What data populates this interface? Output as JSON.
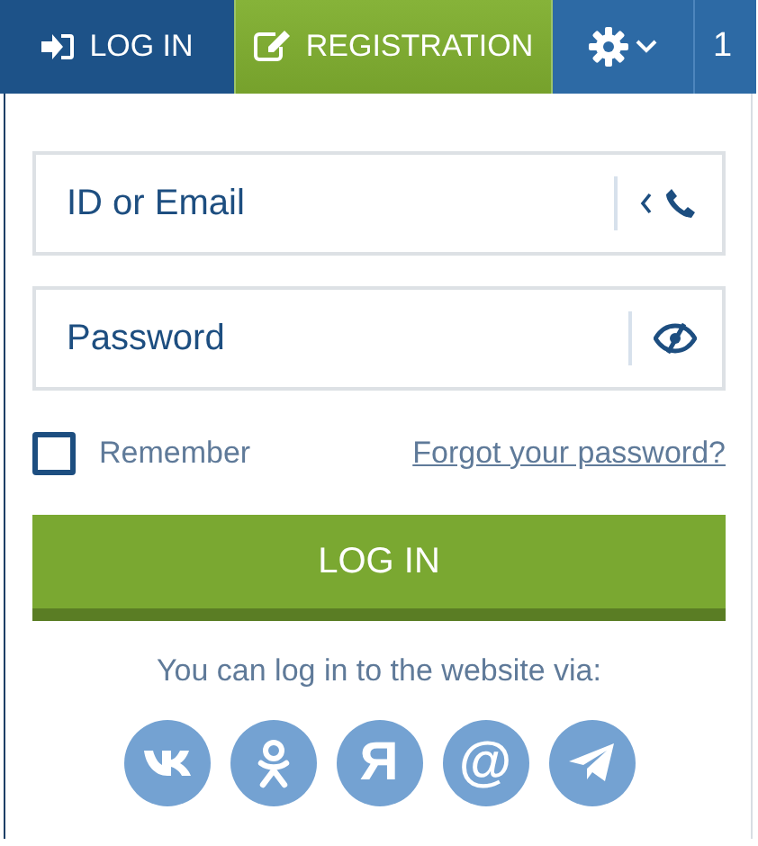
{
  "topbar": [
    {
      "kind": "login",
      "label": "LOG IN"
    },
    {
      "kind": "register",
      "label": "REGISTRATION"
    },
    {
      "kind": "settings"
    },
    {
      "kind": "text",
      "label": "1"
    }
  ],
  "login_form": {
    "id_field": {
      "placeholder": "ID or Email"
    },
    "password_field": {
      "placeholder": "Password"
    },
    "remember": {
      "label": "Remember",
      "checked": false
    },
    "forgot_link": "Forgot your password?",
    "submit": "LOG IN",
    "social_caption": "You can log in to the website via:",
    "social": [
      {
        "kind": "vk"
      },
      {
        "kind": "ok"
      },
      {
        "kind": "char",
        "label": "Я"
      },
      {
        "kind": "char",
        "label": "@"
      },
      {
        "kind": "telegram"
      }
    ]
  }
}
